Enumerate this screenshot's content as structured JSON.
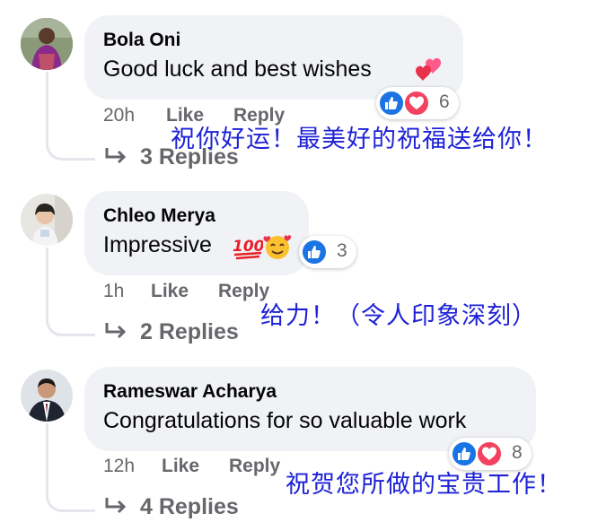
{
  "comments": [
    {
      "author": "Bola Oni",
      "text": "Good luck and best wishes",
      "reaction_count": "6",
      "time": "20h",
      "like_label": "Like",
      "reply_label": "Reply",
      "replies_label": "3 Replies",
      "translation": "祝你好运！最美好的祝福送给你！",
      "reactions": [
        "like-icon",
        "love-icon"
      ]
    },
    {
      "author": "Chleo Merya",
      "text": "Impressive",
      "reaction_count": "3",
      "time": "1h",
      "like_label": "Like",
      "reply_label": "Reply",
      "replies_label": "2 Replies",
      "translation": "给力！（令人印象深刻）",
      "reactions": [
        "like-icon"
      ]
    },
    {
      "author": "Rameswar Acharya",
      "text": "Congratulations for so valuable work",
      "reaction_count": "8",
      "time": "12h",
      "like_label": "Like",
      "reply_label": "Reply",
      "replies_label": "4 Replies",
      "translation": "祝贺您所做的宝贵工作！",
      "reactions": [
        "like-icon",
        "love-icon"
      ]
    }
  ],
  "colors": {
    "bubble": "#f0f2f5",
    "like": "#1b74e4",
    "love": "#f3425f",
    "meta": "#65676b",
    "translation": "#1e22d6"
  }
}
